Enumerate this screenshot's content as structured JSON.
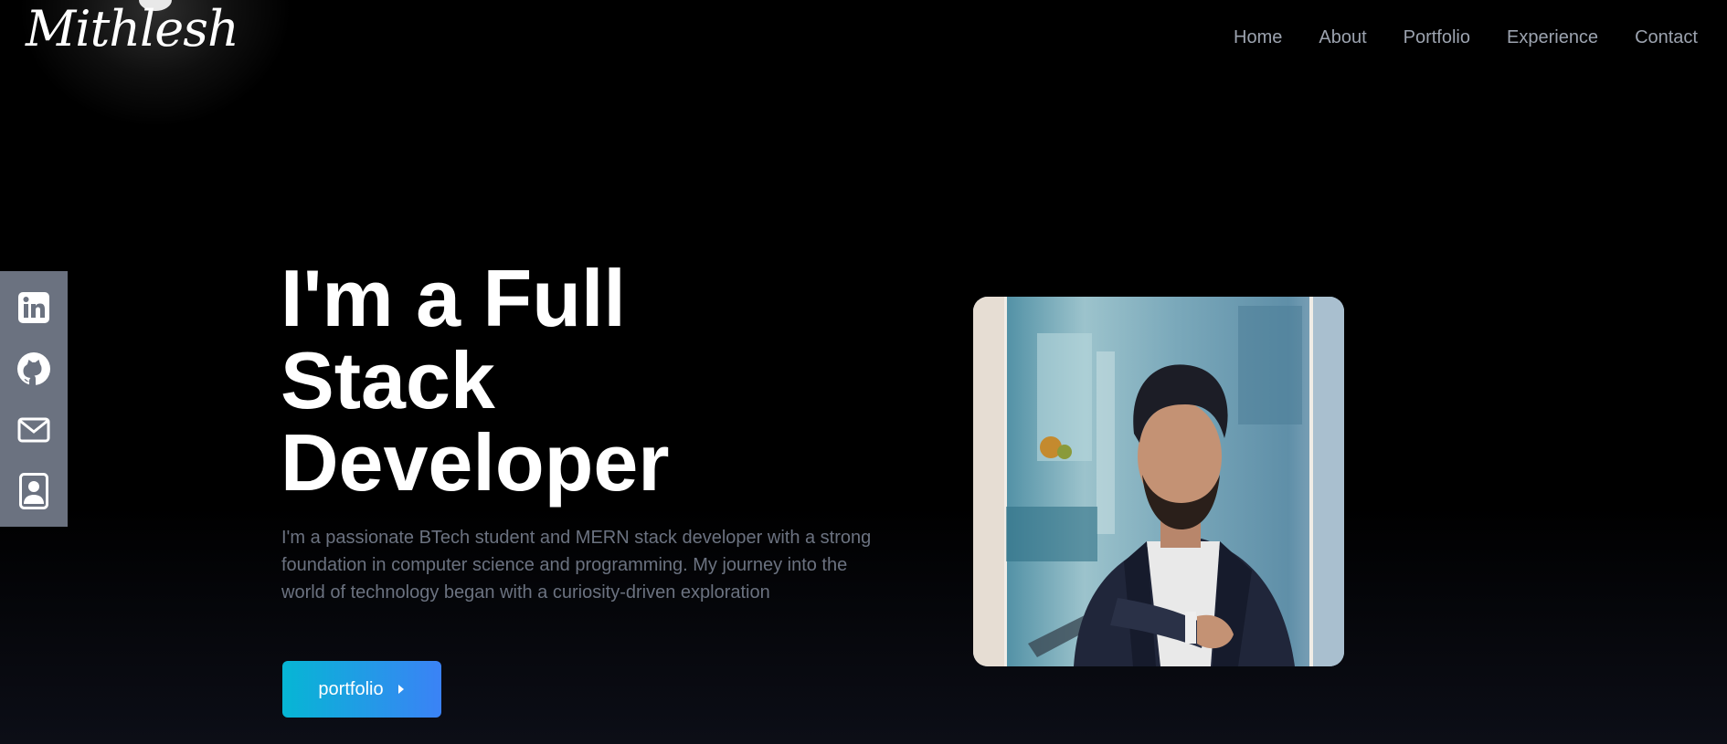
{
  "logo": {
    "text": "Mithlesh"
  },
  "nav": {
    "items": [
      {
        "label": "Home"
      },
      {
        "label": "About"
      },
      {
        "label": "Portfolio"
      },
      {
        "label": "Experience"
      },
      {
        "label": "Contact"
      }
    ]
  },
  "social": {
    "items": [
      {
        "icon": "linkedin-icon"
      },
      {
        "icon": "github-icon"
      },
      {
        "icon": "mail-icon"
      },
      {
        "icon": "resume-icon"
      }
    ]
  },
  "hero": {
    "title_line1": "I'm a Full",
    "title_line2": "Stack",
    "title_line3": "Developer",
    "description": "I'm a passionate BTech student and MERN stack developer with a strong foundation in computer science and programming. My journey into the world of technology began with a curiosity-driven exploration",
    "cta_label": "portfolio",
    "cta_icon": "caret-right-icon"
  },
  "colors": {
    "background": "#000000",
    "nav_text": "#9ca3af",
    "social_bar": "#6b7280",
    "cta_start": "#06b6d4",
    "cta_end": "#3b82f6",
    "description_text": "#6b7280"
  }
}
